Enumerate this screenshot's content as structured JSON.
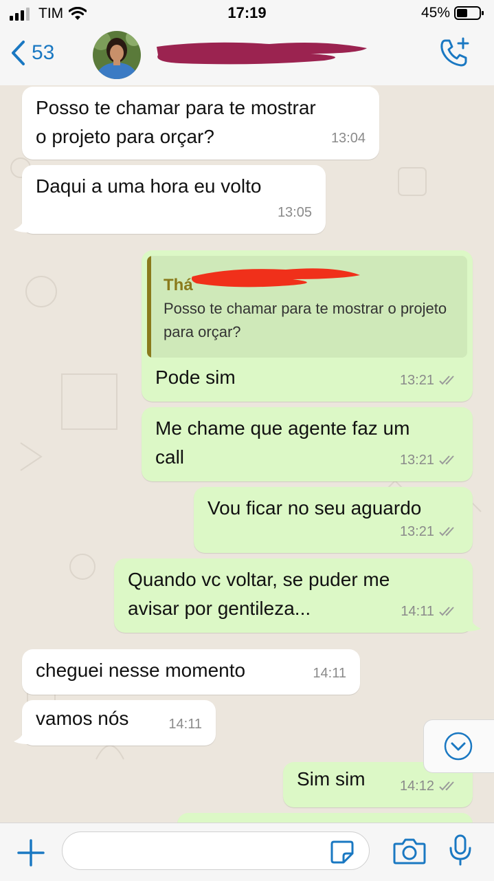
{
  "status_bar": {
    "carrier": "TIM",
    "time": "17:19",
    "battery": "45%"
  },
  "header": {
    "back_count": "53",
    "icons": [
      "back-chevron-icon",
      "add-call-icon"
    ]
  },
  "colors": {
    "accent": "#1a78c2",
    "incoming": "#ffffff",
    "outgoing": "#dcf8c6",
    "quote_author": "#8a7a1c",
    "redaction": "#f0301a",
    "redaction_header": "#9b2350"
  },
  "messages": [
    {
      "dir": "in",
      "text": "Posso te chamar para te mostrar\no projeto para orçar?",
      "time": "13:04"
    },
    {
      "dir": "in",
      "text": "Daqui a uma hora eu volto",
      "time": "13:05"
    },
    {
      "dir": "out",
      "quote_author": "Thá",
      "quote_text": "Posso te chamar para te mostrar o projeto para orçar?",
      "text": "Pode sim",
      "time": "13:21",
      "read": true
    },
    {
      "dir": "out",
      "text": "Me chame que agente faz um\ncall",
      "time": "13:21",
      "read": true
    },
    {
      "dir": "out",
      "text": "Vou ficar no seu aguardo",
      "time": "13:21",
      "read": true
    },
    {
      "dir": "out",
      "text": "Quando vc voltar, se puder me\navisar por gentileza...",
      "time": "14:11",
      "read": true
    },
    {
      "dir": "in",
      "text": "cheguei nesse momento",
      "time": "14:11"
    },
    {
      "dir": "in",
      "text": "vamos nós",
      "time": "14:11"
    },
    {
      "dir": "out",
      "text": "Sim sim",
      "time": "14:12",
      "read": true
    }
  ],
  "composer": {
    "icons": [
      "plus-icon",
      "sticker-icon",
      "camera-icon",
      "microphone-icon"
    ],
    "value": ""
  }
}
